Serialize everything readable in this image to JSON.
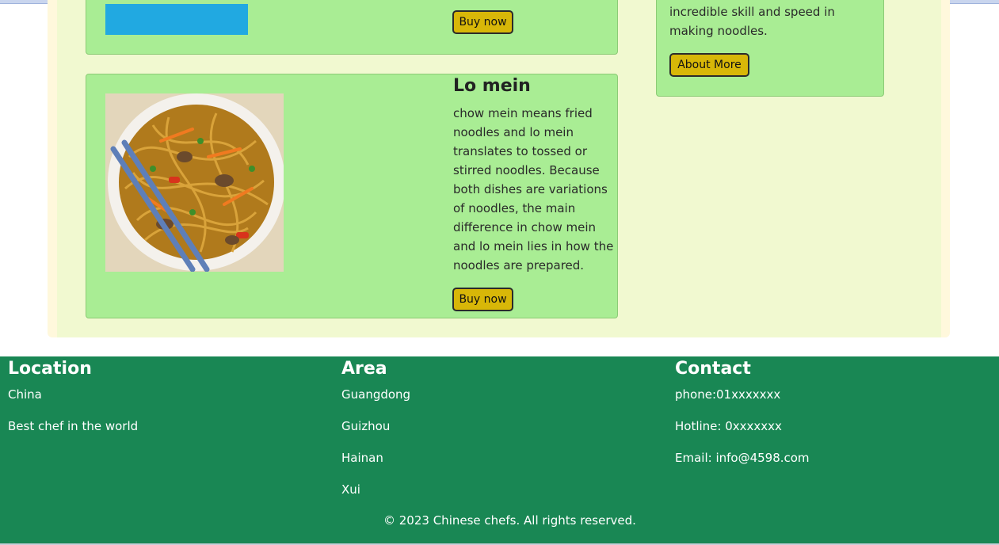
{
  "products": [
    {
      "button_label": "Buy now"
    },
    {
      "title": "Lo mein",
      "description": "chow mein means fried noodles and lo mein translates to tossed or stirred noodles. Because both dishes are variations of noodles, the main difference in chow mein and lo mein lies in how the noodles are prepared.",
      "button_label": "Buy now"
    }
  ],
  "about": {
    "text": "incredible skill and speed in making noodles.",
    "button_label": "About More"
  },
  "footer": {
    "location": {
      "heading": "Location",
      "items": [
        "China",
        "Best chef in the world"
      ]
    },
    "area": {
      "heading": "Area",
      "items": [
        "Guangdong",
        "Guizhou",
        "Hainan",
        "Xui"
      ]
    },
    "contact": {
      "heading": "Contact",
      "items": [
        "phone:01xxxxxxx",
        "Hotline: 0xxxxxxx",
        "Email: info@4598.com"
      ]
    },
    "copyright": "© 2023 Chinese chefs. All rights reserved."
  },
  "colors": {
    "footer_bg": "#198754",
    "card_bg": "#a9ed94",
    "button_bg": "#d8b708",
    "product_image_placeholder": "#21a9e1"
  }
}
